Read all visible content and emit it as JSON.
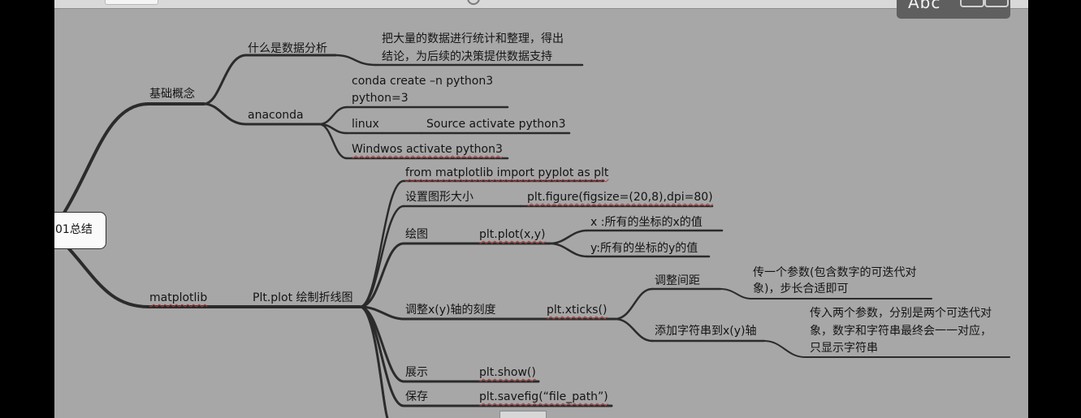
{
  "overlay": {
    "input_mode_label": "Abc"
  },
  "mindmap": {
    "root": "01总结",
    "basics": {
      "label": "基础概念",
      "what_is": {
        "label": "什么是数据分析",
        "desc_line1": "把大量的数据进行统计和整理，得出",
        "desc_line2": "结论，为后续的决策提供数据支持"
      },
      "anaconda": {
        "label": "anaconda",
        "create_line1": "conda create –n python3",
        "create_line2": "python=3",
        "linux_label": "linux",
        "linux_cmd": "Source activate python3",
        "windows_cmd": "Windwos activate python3"
      }
    },
    "matplotlib": {
      "label": "matplotlib",
      "plot": {
        "label": "Plt.plot 绘制折线图",
        "import_line": "from matplotlib import pyplot as plt",
        "figsize": {
          "label": "设置图形大小",
          "cmd": "plt.figure(figsize=(20,8),dpi=80)"
        },
        "draw": {
          "label": "绘图",
          "cmd": "plt.plot(x,y)",
          "x_desc": "x :所有的坐标的x的值",
          "y_desc": "y:所有的坐标的y的值"
        },
        "ticks": {
          "label": "调整x(y)轴的刻度",
          "cmd": "plt.xticks()",
          "spacing": {
            "label": "调整间距",
            "desc_line1": "传一个参数(包含数字的可迭代对",
            "desc_line2": "象)，步长合适即可"
          },
          "strings": {
            "label": "添加字符串到x(y)轴",
            "desc_line1": "传入两个参数，分别是两个可迭代对",
            "desc_line2": "象，数字和字符串最终会一一对应，",
            "desc_line3": "只显示字符串"
          }
        },
        "show": {
          "label": "展示",
          "cmd": "plt.show()"
        },
        "save": {
          "label": "保存",
          "cmd": "plt.savefig(“file_path”)"
        }
      }
    }
  }
}
